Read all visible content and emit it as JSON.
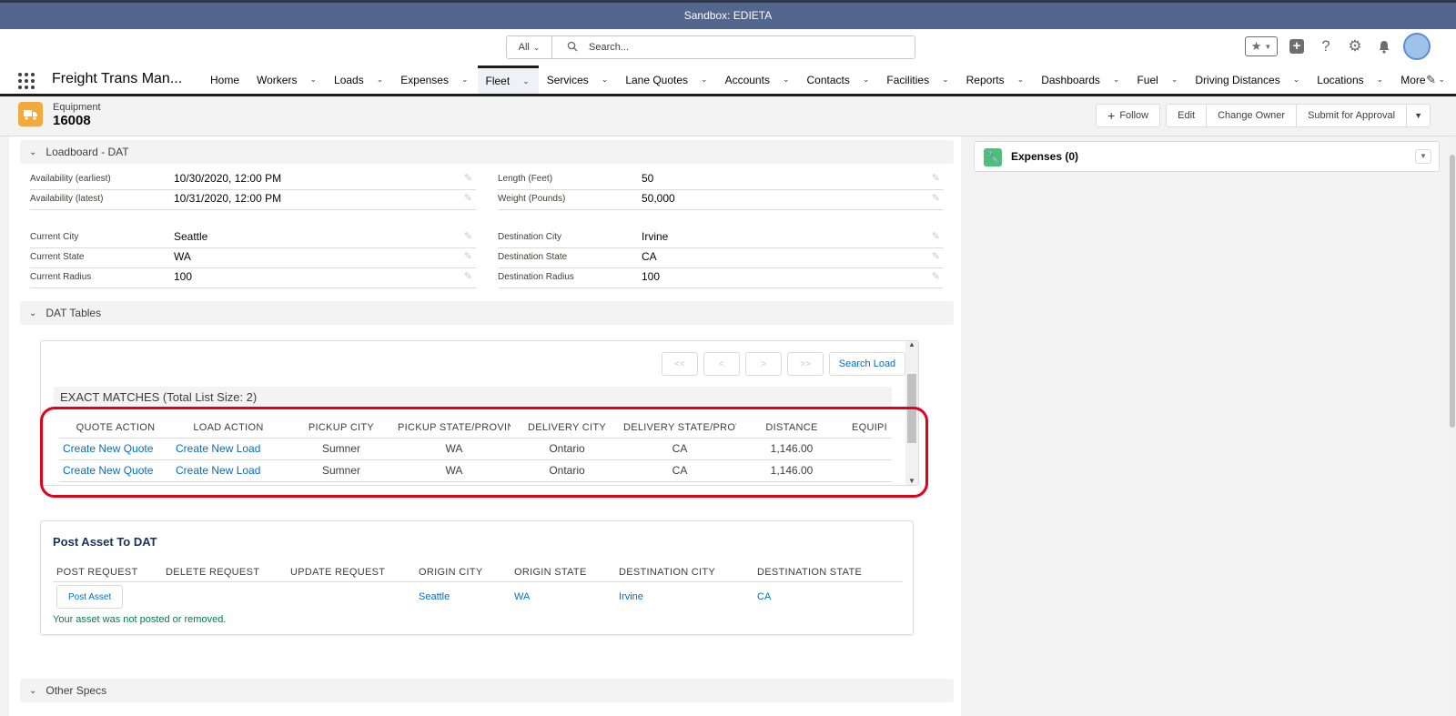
{
  "sandbox": {
    "label": "Sandbox: EDIETA"
  },
  "global_header": {
    "search_scope": "All",
    "search_placeholder": "Search..."
  },
  "nav": {
    "app_name": "Freight Trans Man...",
    "items": [
      {
        "label": "Home",
        "has_menu": false
      },
      {
        "label": "Workers",
        "has_menu": true
      },
      {
        "label": "Loads",
        "has_menu": true
      },
      {
        "label": "Expenses",
        "has_menu": true
      },
      {
        "label": "Fleet",
        "has_menu": true,
        "active": true
      },
      {
        "label": "Services",
        "has_menu": true
      },
      {
        "label": "Lane Quotes",
        "has_menu": true
      },
      {
        "label": "Accounts",
        "has_menu": true
      },
      {
        "label": "Contacts",
        "has_menu": true
      },
      {
        "label": "Facilities",
        "has_menu": true
      },
      {
        "label": "Reports",
        "has_menu": true
      },
      {
        "label": "Dashboards",
        "has_menu": true
      },
      {
        "label": "Fuel",
        "has_menu": true
      },
      {
        "label": "Driving Distances",
        "has_menu": true
      },
      {
        "label": "Locations",
        "has_menu": true
      },
      {
        "label": "More",
        "has_menu": true
      }
    ]
  },
  "record": {
    "type": "Equipment",
    "name": "16008",
    "actions": {
      "follow": "Follow",
      "edit": "Edit",
      "change_owner": "Change Owner",
      "submit": "Submit for Approval"
    }
  },
  "loadboard": {
    "title": "Loadboard - DAT",
    "fields": {
      "availability_earliest": {
        "label": "Availability (earliest)",
        "value": "10/30/2020, 12:00 PM"
      },
      "availability_latest": {
        "label": "Availability (latest)",
        "value": "10/31/2020, 12:00 PM"
      },
      "length": {
        "label": "Length (Feet)",
        "value": "50"
      },
      "weight": {
        "label": "Weight (Pounds)",
        "value": "50,000"
      },
      "current_city": {
        "label": "Current City",
        "value": "Seattle"
      },
      "current_state": {
        "label": "Current State",
        "value": "WA"
      },
      "current_radius": {
        "label": "Current Radius",
        "value": "100"
      },
      "destination_city": {
        "label": "Destination City",
        "value": "Irvine"
      },
      "destination_state": {
        "label": "Destination State",
        "value": "CA"
      },
      "destination_radius": {
        "label": "Destination Radius",
        "value": "100"
      }
    }
  },
  "dat_tables": {
    "title": "DAT Tables",
    "pager": {
      "first": "<<",
      "prev": "<",
      "next": ">",
      "last": ">>",
      "search": "Search Load"
    },
    "exact_matches_title": "EXACT MATCHES (Total List Size: 2)",
    "columns": [
      "QUOTE ACTION",
      "LOAD ACTION",
      "PICKUP CITY",
      "PICKUP STATE/PROVIN",
      "DELIVERY CITY",
      "DELIVERY STATE/PROV",
      "DISTANCE",
      "EQUIPI"
    ],
    "rows": [
      {
        "quote_action": "Create New Quote",
        "load_action": "Create New Load",
        "pickup_city": "Sumner",
        "pickup_state": "WA",
        "delivery_city": "Ontario",
        "delivery_state": "CA",
        "distance": "1,146.00",
        "equipment": ""
      },
      {
        "quote_action": "Create New Quote",
        "load_action": "Create New Load",
        "pickup_city": "Sumner",
        "pickup_state": "WA",
        "delivery_city": "Ontario",
        "delivery_state": "CA",
        "distance": "1,146.00",
        "equipment": ""
      }
    ]
  },
  "post_asset": {
    "title": "Post Asset To DAT",
    "columns": [
      "POST REQUEST",
      "DELETE REQUEST",
      "UPDATE REQUEST",
      "ORIGIN CITY",
      "ORIGIN STATE",
      "DESTINATION CITY",
      "DESTINATION STATE"
    ],
    "row": {
      "button": "Post Asset",
      "origin_city": "Seattle",
      "origin_state": "WA",
      "destination_city": "Irvine",
      "destination_state": "CA"
    },
    "message": "Your asset was not posted or removed."
  },
  "other_specs": {
    "title": "Other Specs"
  },
  "expenses": {
    "title": "Expenses (0)"
  },
  "colors": {
    "sandbox_bar": "#53668e",
    "link": "#006dcc",
    "highlight": "#e3001b",
    "equipment_icon": "#f2a93f",
    "expenses_icon": "#4bc076",
    "success_text": "#027e46"
  },
  "icons": {
    "search": "search-icon",
    "favorites": "star-icon",
    "global_add": "plus-icon",
    "help": "question-icon",
    "setup": "gear-icon",
    "notifications": "bell-icon",
    "app_launcher": "waffle-icon",
    "equipment": "truck-icon",
    "expenses": "wrench-icon"
  }
}
